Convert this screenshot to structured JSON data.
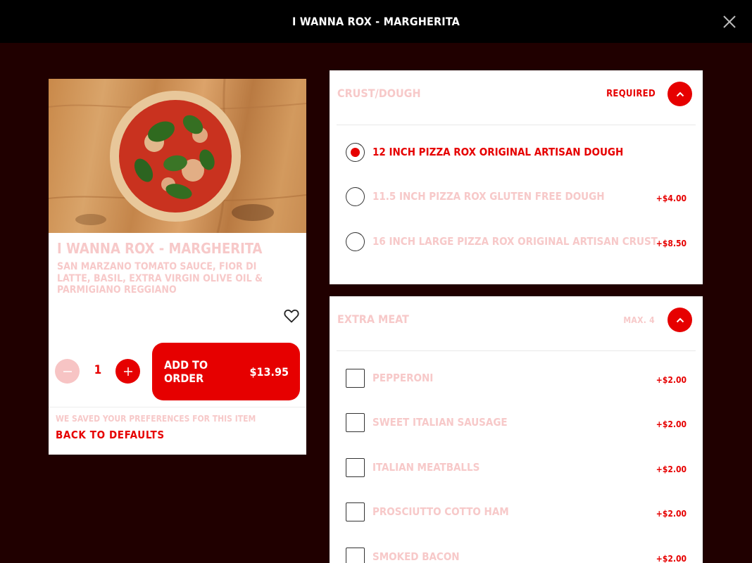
{
  "header": {
    "title": "I WANNA ROX - MARGHERITA",
    "close_icon": "close-icon"
  },
  "product": {
    "name": "I WANNA ROX - MARGHERITA",
    "description": "SAN MARZANO TOMATO SAUCE, FIOR DI LATTE, BASIL, EXTRA VIRGIN OLIVE OIL & PARMIGIANO REGGIANO",
    "favorite_icon": "heart-outline-icon",
    "quantity": "1",
    "add_to_order_label": "ADD TO ORDER",
    "price": "$13.95",
    "saved_note": "WE SAVED YOUR PREFERENCES FOR THIS ITEM",
    "back_to_defaults": "BACK TO DEFAULTS"
  },
  "crust": {
    "title": "CRUST/DOUGH",
    "badge": "REQUIRED",
    "options": [
      {
        "label": "12 INCH PIZZA ROX ORIGINAL ARTISAN DOUGH",
        "price": "",
        "selected": true
      },
      {
        "label": "11.5 INCH PIZZA ROX GLUTEN FREE DOUGH",
        "price": "+$4.00",
        "selected": false
      },
      {
        "label": "16 INCH LARGE PIZZA ROX ORIGINAL ARTISAN CRUST",
        "price": "+$8.50",
        "selected": false
      }
    ]
  },
  "extra_meat": {
    "title": "EXTRA MEAT",
    "badge": "MAX. 4",
    "options": [
      {
        "label": "PEPPERONI",
        "price": "+$2.00",
        "checked": false
      },
      {
        "label": "SWEET ITALIAN SAUSAGE",
        "price": "+$2.00",
        "checked": false
      },
      {
        "label": "ITALIAN MEATBALLS",
        "price": "+$2.00",
        "checked": false
      },
      {
        "label": "PROSCIUTTO COTTO HAM",
        "price": "+$2.00",
        "checked": false
      },
      {
        "label": "SMOKED BACON",
        "price": "+$2.00",
        "checked": false
      }
    ]
  },
  "colors": {
    "background": "#200000",
    "topbar": "#000000",
    "accent_red": "#e60000",
    "muted_pink": "#f7c9c9"
  }
}
